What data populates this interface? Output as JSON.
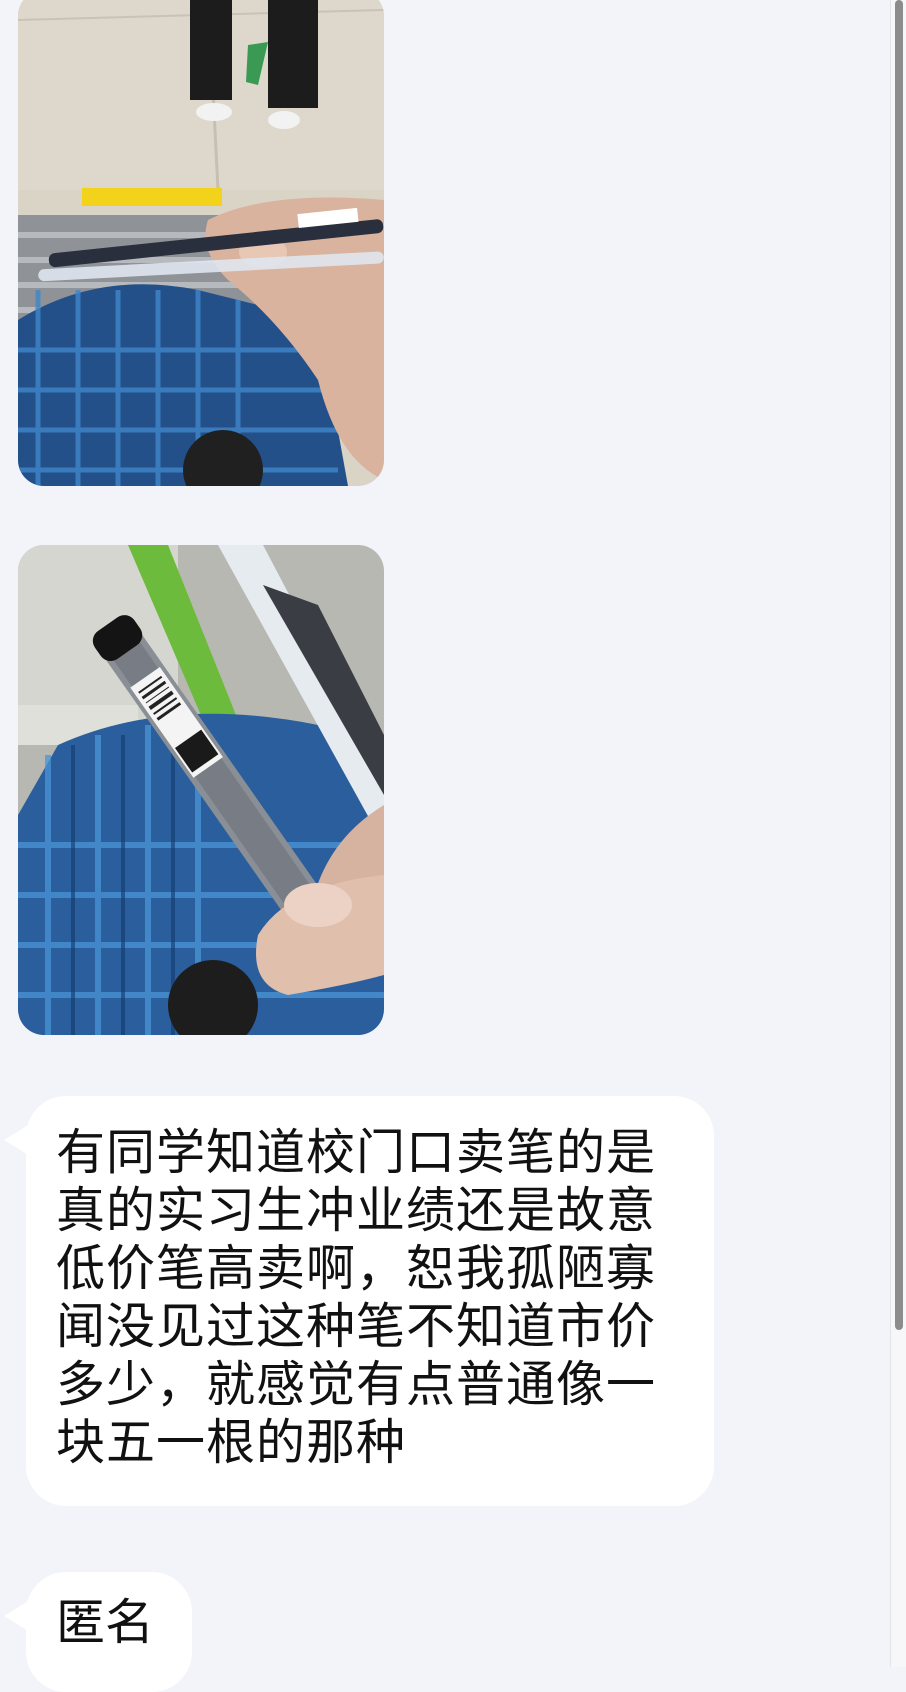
{
  "messages": [
    {
      "type": "image",
      "description_icon": "photo-pen-on-platform"
    },
    {
      "type": "image",
      "description_icon": "photo-pen-closeup"
    },
    {
      "type": "text",
      "text": "有同学知道校门口卖笔的是真的实习生冲业绩还是故意低价笔高卖啊，恕我孤陋寡闻没见过这种笔不知道市价多少，就感觉有点普通像一块五一根的那种"
    },
    {
      "type": "text",
      "text": "匿名"
    }
  ],
  "colors": {
    "background": "#f3f4f9",
    "bubble": "#ffffff",
    "text": "#111111",
    "scroll_thumb": "#8c8c8c"
  }
}
